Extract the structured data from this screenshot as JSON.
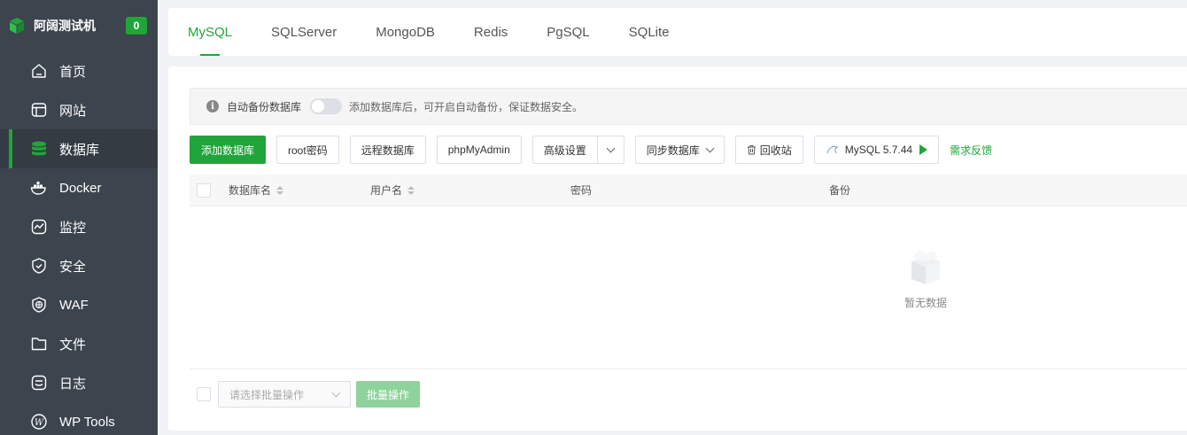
{
  "sidebar": {
    "brand": "阿阔测试机",
    "badge": "0",
    "items": [
      {
        "label": "首页",
        "icon": "home-icon"
      },
      {
        "label": "网站",
        "icon": "website-icon"
      },
      {
        "label": "数据库",
        "icon": "database-icon",
        "active": true
      },
      {
        "label": "Docker",
        "icon": "docker-icon"
      },
      {
        "label": "监控",
        "icon": "monitor-icon"
      },
      {
        "label": "安全",
        "icon": "shield-icon"
      },
      {
        "label": "WAF",
        "icon": "waf-icon"
      },
      {
        "label": "文件",
        "icon": "folder-icon"
      },
      {
        "label": "日志",
        "icon": "log-icon"
      },
      {
        "label": "WP Tools",
        "icon": "wordpress-icon"
      }
    ]
  },
  "tabs": [
    "MySQL",
    "SQLServer",
    "MongoDB",
    "Redis",
    "PgSQL",
    "SQLite"
  ],
  "notice": {
    "label": "自动备份数据库",
    "hint": "添加数据库后，可开启自动备份，保证数据安全。"
  },
  "toolbar": {
    "add": "添加数据库",
    "root": "root密码",
    "remote": "远程数据库",
    "phpmyadmin": "phpMyAdmin",
    "advanced": "高级设置",
    "sync": "同步数据库",
    "recycle": "回收站",
    "version": "MySQL 5.7.44",
    "feedback": "需求反馈"
  },
  "table": {
    "columns": [
      "数据库名",
      "用户名",
      "密码",
      "备份"
    ],
    "empty": "暂无数据"
  },
  "footer": {
    "select_placeholder": "请选择批量操作",
    "batch_button": "批量操作"
  },
  "colors": {
    "accent": "#20a53a",
    "sidebar": "#3c444d"
  }
}
